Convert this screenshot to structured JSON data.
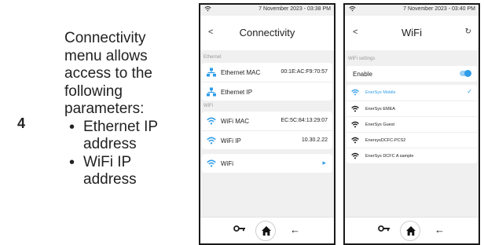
{
  "step": "4",
  "description": {
    "lines": [
      "Connectivity",
      "menu allows",
      "access to the",
      "following",
      "parameters:"
    ],
    "bullets": [
      {
        "line1": "Ethernet IP",
        "line2": "address"
      },
      {
        "line1": "WiFi IP",
        "line2": "address"
      }
    ]
  },
  "screen1": {
    "status_time": "7 November 2023 - 03:38 PM",
    "back": "<",
    "title": "Connectivity",
    "ethernet_section": "Ethernet",
    "ethernet_mac_label": "Ethernet MAC",
    "ethernet_mac_value": "00:1E:AC:F9:70:57",
    "ethernet_ip_label": "Ethernet IP",
    "ethernet_ip_value": "",
    "wifi_section": "WiFi",
    "wifi_mac_label": "WiFi MAC",
    "wifi_mac_value": "EC:5C:84:13:29:07",
    "wifi_ip_label": "WiFi IP",
    "wifi_ip_value": "10.30.2.22",
    "wifi_label": "WiFi",
    "wifi_chevron": "▸"
  },
  "screen2": {
    "status_time": "7 November 2023 - 03:40 PM",
    "back": "<",
    "title": "WiFi",
    "refresh": "↻",
    "settings_section": "WiFi settings",
    "enable_label": "Enable",
    "enable_on": true,
    "networks": [
      {
        "name": "EnerSys Mobile",
        "connected": true
      },
      {
        "name": "EnerSys EMEA",
        "connected": false
      },
      {
        "name": "EnerSys Guest",
        "connected": false
      },
      {
        "name": "EnersysDCFC-PCS2",
        "connected": false
      },
      {
        "name": "EnerSys DCFC A sample",
        "connected": false
      }
    ],
    "check": "✓"
  },
  "bottom_bar": {
    "icons": [
      "key-icon",
      "home-icon",
      "back-arrow-icon"
    ],
    "back_arrow": "←"
  },
  "colors": {
    "accent": "#2f9de8",
    "screen_bg": "#f0f0f0",
    "frame": "#1a1a1a"
  }
}
